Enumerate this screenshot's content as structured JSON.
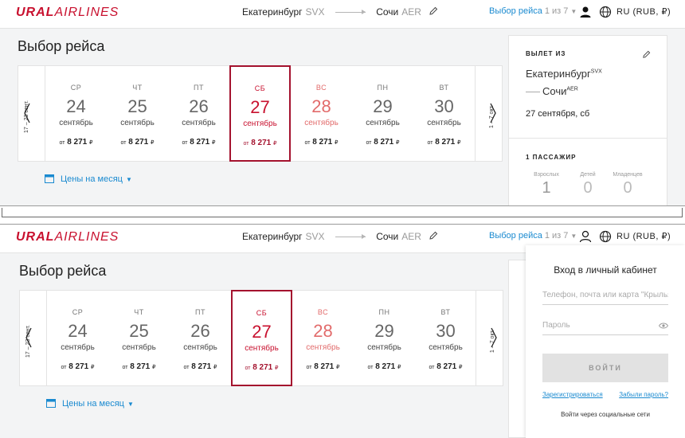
{
  "brand": {
    "logo_bold": "URAL",
    "logo_light": "AIRLINES",
    "color": "#c8102e"
  },
  "header": {
    "from_city": "Екатеринбург",
    "from_code": "SVX",
    "to_city": "Сочи",
    "to_code": "AER",
    "step_label": "Выбор рейса",
    "step_count": "1 из 7",
    "lang": "RU (RUB, ₽)"
  },
  "page_title": "Выбор рейса",
  "date_strip": {
    "prev_range": "17 – 23 сент.",
    "next_range": "1 – 7 окт.",
    "days": [
      {
        "dow": "СР",
        "num": "24",
        "month": "сентябрь",
        "price_prefix": "от",
        "price": "8 271",
        "currency": "₽"
      },
      {
        "dow": "ЧТ",
        "num": "25",
        "month": "сентябрь",
        "price_prefix": "от",
        "price": "8 271",
        "currency": "₽"
      },
      {
        "dow": "ПТ",
        "num": "26",
        "month": "сентябрь",
        "price_prefix": "от",
        "price": "8 271",
        "currency": "₽"
      },
      {
        "dow": "СБ",
        "num": "27",
        "month": "сентябрь",
        "price_prefix": "от",
        "price": "8 271",
        "currency": "₽"
      },
      {
        "dow": "ВС",
        "num": "28",
        "month": "сентябрь",
        "price_prefix": "от",
        "price": "8 271",
        "currency": "₽"
      },
      {
        "dow": "ПН",
        "num": "29",
        "month": "сентябрь",
        "price_prefix": "от",
        "price": "8 271",
        "currency": "₽"
      },
      {
        "dow": "ВТ",
        "num": "30",
        "month": "сентябрь",
        "price_prefix": "от",
        "price": "8 271",
        "currency": "₽"
      }
    ]
  },
  "month_prices_label": "Цены на месяц",
  "summary": {
    "heading": "ВЫЛЕТ ИЗ",
    "from_city": "Екатеринбург",
    "from_code": "SVX",
    "to_city": "Сочи",
    "to_code": "AER",
    "date": "27 сентября, сб",
    "pax_heading": "1 ПАССАЖИР",
    "adults_label": "Взрослых",
    "adults": "1",
    "children_label": "Детей",
    "children": "0",
    "infants_label": "Младенцев",
    "infants": "0"
  },
  "login": {
    "title": "Вход в личный кабинет",
    "phone_placeholder": "Телефон, почта или карта \"Крылья\"",
    "password_placeholder": "Пароль",
    "submit": "ВОЙТИ",
    "register": "Зарегистрироваться",
    "forgot": "Забыли пароль?",
    "social": "Войти через социальные сети"
  }
}
